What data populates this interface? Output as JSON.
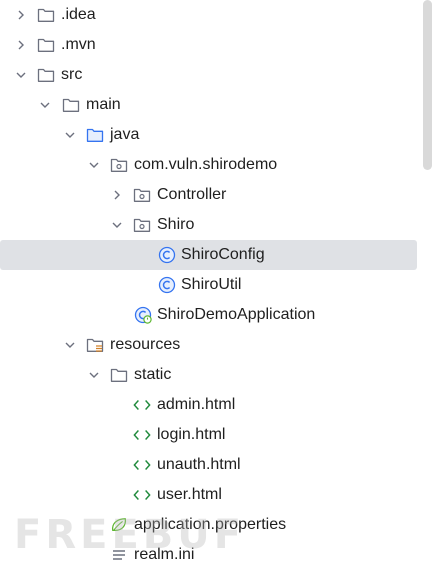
{
  "tree": [
    {
      "label": ".idea",
      "icon": "folder-icon",
      "expanded": false
    },
    {
      "label": ".mvn",
      "icon": "folder-icon",
      "expanded": false
    },
    {
      "label": "src",
      "icon": "folder-icon",
      "expanded": true
    },
    {
      "label": "main",
      "icon": "folder-icon",
      "expanded": true
    },
    {
      "label": "java",
      "icon": "source-folder-icon",
      "expanded": true
    },
    {
      "label": "com.vuln.shirodemo",
      "icon": "package-icon",
      "expanded": true
    },
    {
      "label": "Controller",
      "icon": "package-icon",
      "expanded": false
    },
    {
      "label": "Shiro",
      "icon": "package-icon",
      "expanded": true
    },
    {
      "label": "ShiroConfig",
      "icon": "class-icon",
      "selected": true
    },
    {
      "label": "ShiroUtil",
      "icon": "class-icon"
    },
    {
      "label": "ShiroDemoApplication",
      "icon": "spring-boot-class-icon"
    },
    {
      "label": "resources",
      "icon": "resources-folder-icon",
      "expanded": true
    },
    {
      "label": "static",
      "icon": "folder-icon",
      "expanded": true
    },
    {
      "label": "admin.html",
      "icon": "html-icon"
    },
    {
      "label": "login.html",
      "icon": "html-icon"
    },
    {
      "label": "unauth.html",
      "icon": "html-icon"
    },
    {
      "label": "user.html",
      "icon": "html-icon"
    },
    {
      "label": "application.properties",
      "icon": "spring-properties-icon"
    },
    {
      "label": "realm.ini",
      "icon": "text-file-icon"
    }
  ],
  "watermark": "FREEBUF",
  "colors": {
    "selection": "#dfe1e5",
    "folder_stroke": "#6c707e",
    "source_folder_stroke": "#3574f0",
    "class_icon": "#3574f0",
    "html_icon": "#208a3c",
    "spring_icon": "#5fb832"
  }
}
